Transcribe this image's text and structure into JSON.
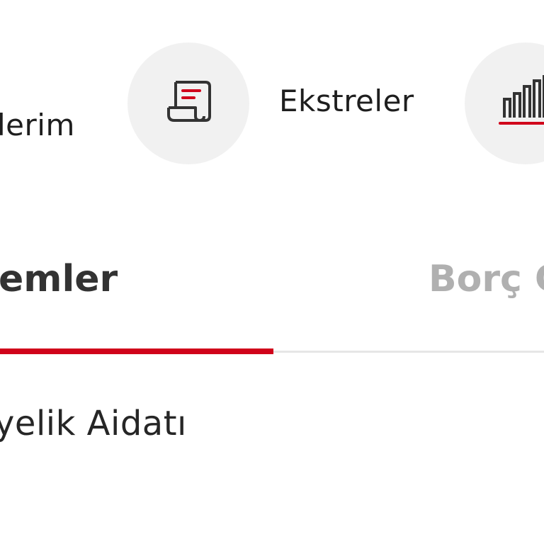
{
  "quick_actions": [
    {
      "label": "lerim",
      "icon": "list-icon"
    },
    {
      "label": "Ekstreler",
      "icon": "statement-scroll-icon"
    },
    {
      "label": "",
      "icon": "bar-chart-icon"
    }
  ],
  "tabs": [
    {
      "label": "emler",
      "active": true
    },
    {
      "label": "Borç G",
      "active": false
    }
  ],
  "list": {
    "items": [
      "yelik Aidatı"
    ]
  },
  "colors": {
    "accent": "#d0021b",
    "icon_circle": "#f1f1f1",
    "tab_inactive": "#b0b0b0"
  }
}
